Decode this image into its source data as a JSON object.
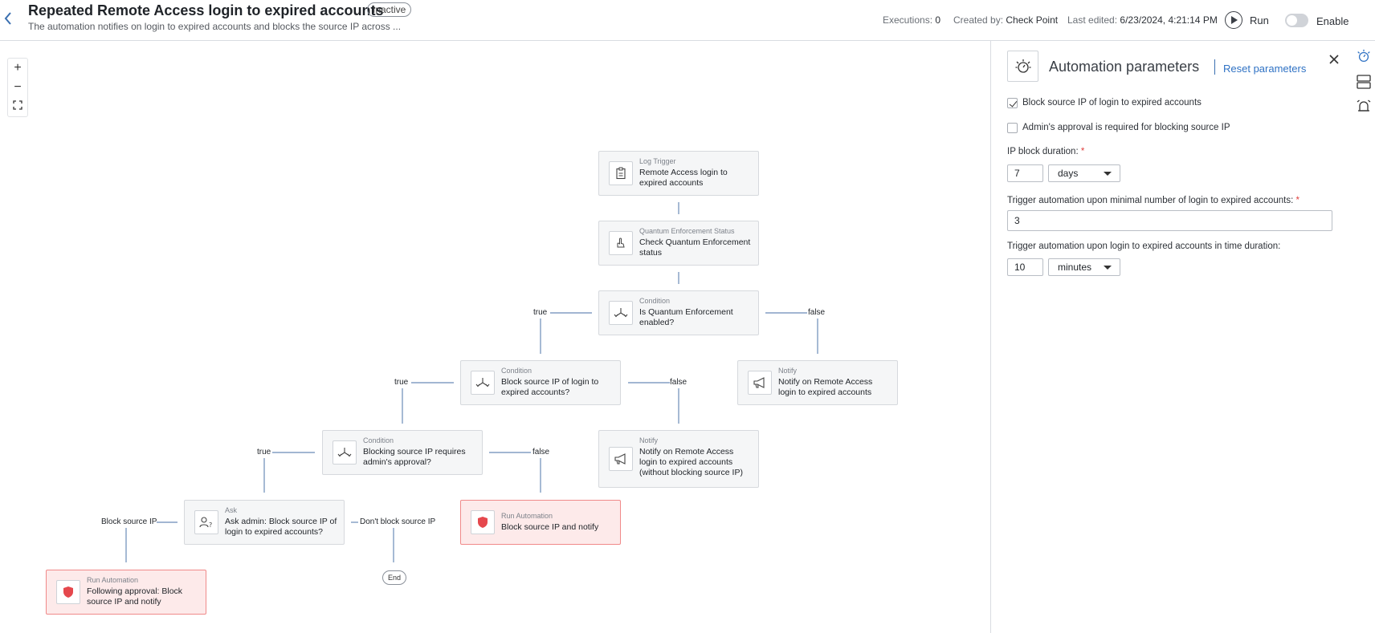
{
  "header": {
    "title": "Repeated Remote Access login to expired accounts",
    "status_badge": "Inactive",
    "subtitle": "The automation notifies on login to expired accounts and blocks the source IP across ...",
    "executions_label": "Executions:",
    "executions_value": "0",
    "created_by_label": "Created by:",
    "created_by_value": "Check Point",
    "last_edited_label": "Last edited:",
    "last_edited_value": "6/23/2024, 4:21:14 PM",
    "run_label": "Run",
    "enable_label": "Enable",
    "enable_on": false
  },
  "zoom": {
    "in": "+",
    "out": "−",
    "fit": "fit"
  },
  "flow": {
    "nodes": {
      "log_trigger": {
        "type": "Log Trigger",
        "text": "Remote Access login to expired accounts"
      },
      "quantum_status": {
        "type": "Quantum Enforcement Status",
        "text": "Check Quantum Enforcement status"
      },
      "cond_quantum": {
        "type": "Condition",
        "text": "Is Quantum Enforcement enabled?"
      },
      "cond_block": {
        "type": "Condition",
        "text": "Block source IP of login to expired accounts?"
      },
      "notify_main": {
        "type": "Notify",
        "text": "Notify on Remote Access login to expired accounts"
      },
      "cond_approval": {
        "type": "Condition",
        "text": "Blocking source IP requires admin's approval?"
      },
      "notify_no_block": {
        "type": "Notify",
        "text": "Notify on Remote Access login to expired accounts (without blocking source IP)"
      },
      "ask_admin": {
        "type": "Ask",
        "text": "Ask admin: Block source IP of login to expired accounts?"
      },
      "run_block": {
        "type": "Run Automation",
        "text": "Block source IP and notify"
      },
      "run_approval": {
        "type": "Run Automation",
        "text": "Following approval: Block source IP and notify"
      },
      "end": {
        "text": "End"
      }
    },
    "edge_labels": {
      "true": "true",
      "false": "false",
      "block": "Block source IP",
      "dont_block": "Don't block source IP"
    }
  },
  "panel": {
    "title": "Automation parameters",
    "reset_label": "Reset parameters",
    "block_checkbox": {
      "label": "Block source IP of login to expired accounts",
      "checked": true
    },
    "approval_checkbox": {
      "label": "Admin's approval is required for blocking source IP",
      "checked": false
    },
    "ip_block_duration": {
      "label": "IP block duration:",
      "required": "*",
      "value": "7",
      "unit": "days"
    },
    "min_logins": {
      "label": "Trigger automation upon minimal number of login to expired accounts:",
      "required": "*",
      "value": "3"
    },
    "time_window": {
      "label": "Trigger automation upon login to expired accounts in time duration:",
      "value": "10",
      "unit": "minutes"
    }
  },
  "colors": {
    "accent": "#2f72c4",
    "run_automation_bg": "#fdeaea",
    "run_automation_border": "#f08a8a",
    "shield": "#e5484d",
    "edge": "#6b8bb8"
  },
  "icons": {
    "rail": [
      "automation-icon",
      "layout-icon",
      "alarm-icon"
    ]
  }
}
